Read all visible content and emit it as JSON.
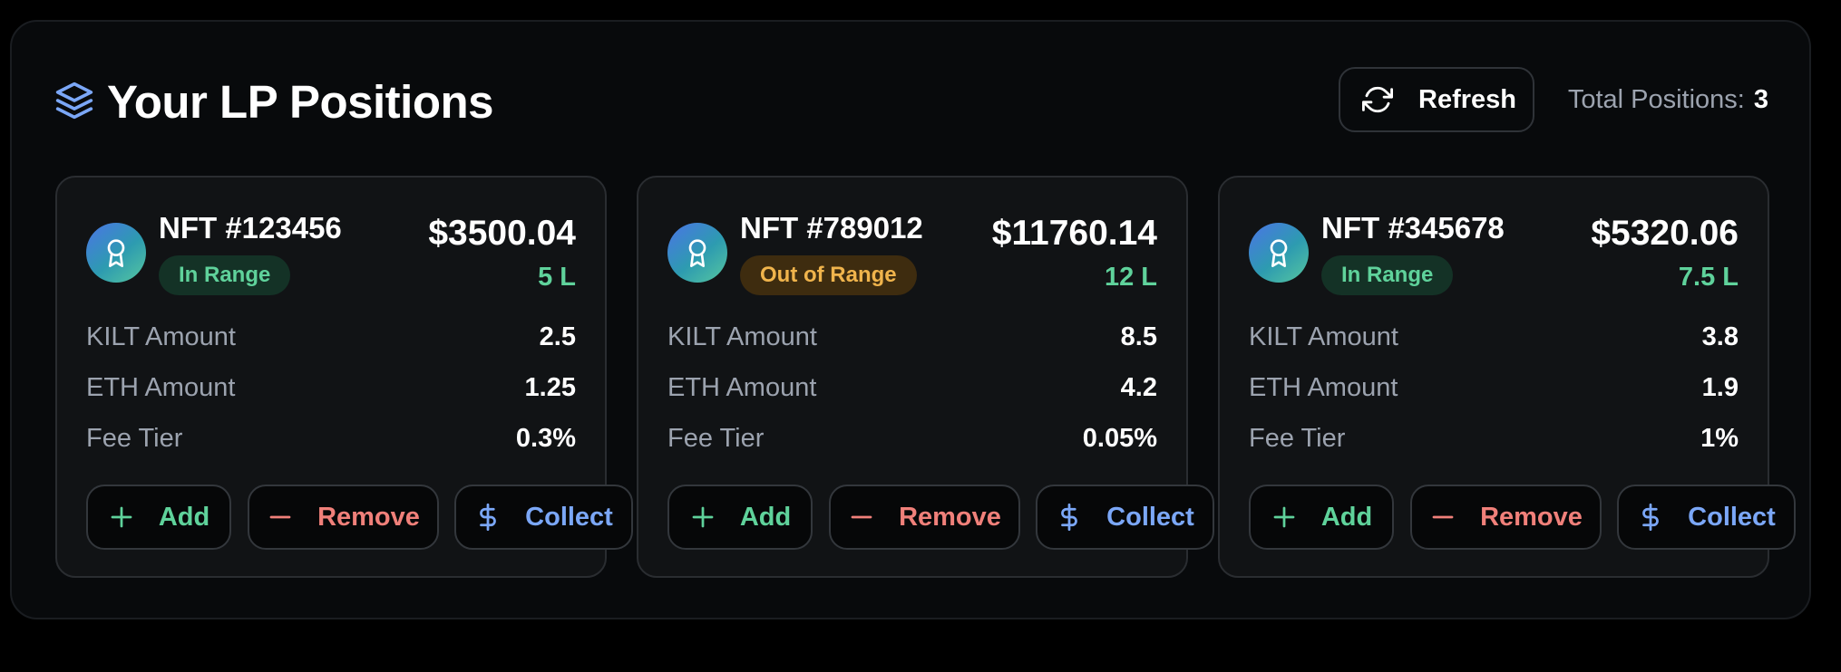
{
  "header": {
    "title": "Your LP Positions",
    "refresh_label": "Refresh",
    "total_label": "Total Positions:",
    "total_value": "3"
  },
  "colors": {
    "accent_blue": "#7ba7f7",
    "in_range": "#5fd29b",
    "out_of_range": "#f0b44c",
    "remove": "#f0807a"
  },
  "icons": {
    "header": "layers-icon",
    "refresh": "refresh-icon",
    "avatar": "award-icon",
    "add": "plus-icon",
    "remove": "minus-icon",
    "collect": "dollar-icon"
  },
  "positions": [
    {
      "nft": "NFT #123456",
      "status": "In Range",
      "value": "$3500.04",
      "liquidity": "5 L",
      "kilt_label": "KILT Amount",
      "kilt": "2.5",
      "eth_label": "ETH Amount",
      "eth": "1.25",
      "fee_label": "Fee Tier",
      "fee": "0.3%",
      "add_label": "Add",
      "remove_label": "Remove",
      "collect_label": "Collect"
    },
    {
      "nft": "NFT #789012",
      "status": "Out of Range",
      "value": "$11760.14",
      "liquidity": "12 L",
      "kilt_label": "KILT Amount",
      "kilt": "8.5",
      "eth_label": "ETH Amount",
      "eth": "4.2",
      "fee_label": "Fee Tier",
      "fee": "0.05%",
      "add_label": "Add",
      "remove_label": "Remove",
      "collect_label": "Collect"
    },
    {
      "nft": "NFT #345678",
      "status": "In Range",
      "value": "$5320.06",
      "liquidity": "7.5 L",
      "kilt_label": "KILT Amount",
      "kilt": "3.8",
      "eth_label": "ETH Amount",
      "eth": "1.9",
      "fee_label": "Fee Tier",
      "fee": "1%",
      "add_label": "Add",
      "remove_label": "Remove",
      "collect_label": "Collect"
    }
  ]
}
